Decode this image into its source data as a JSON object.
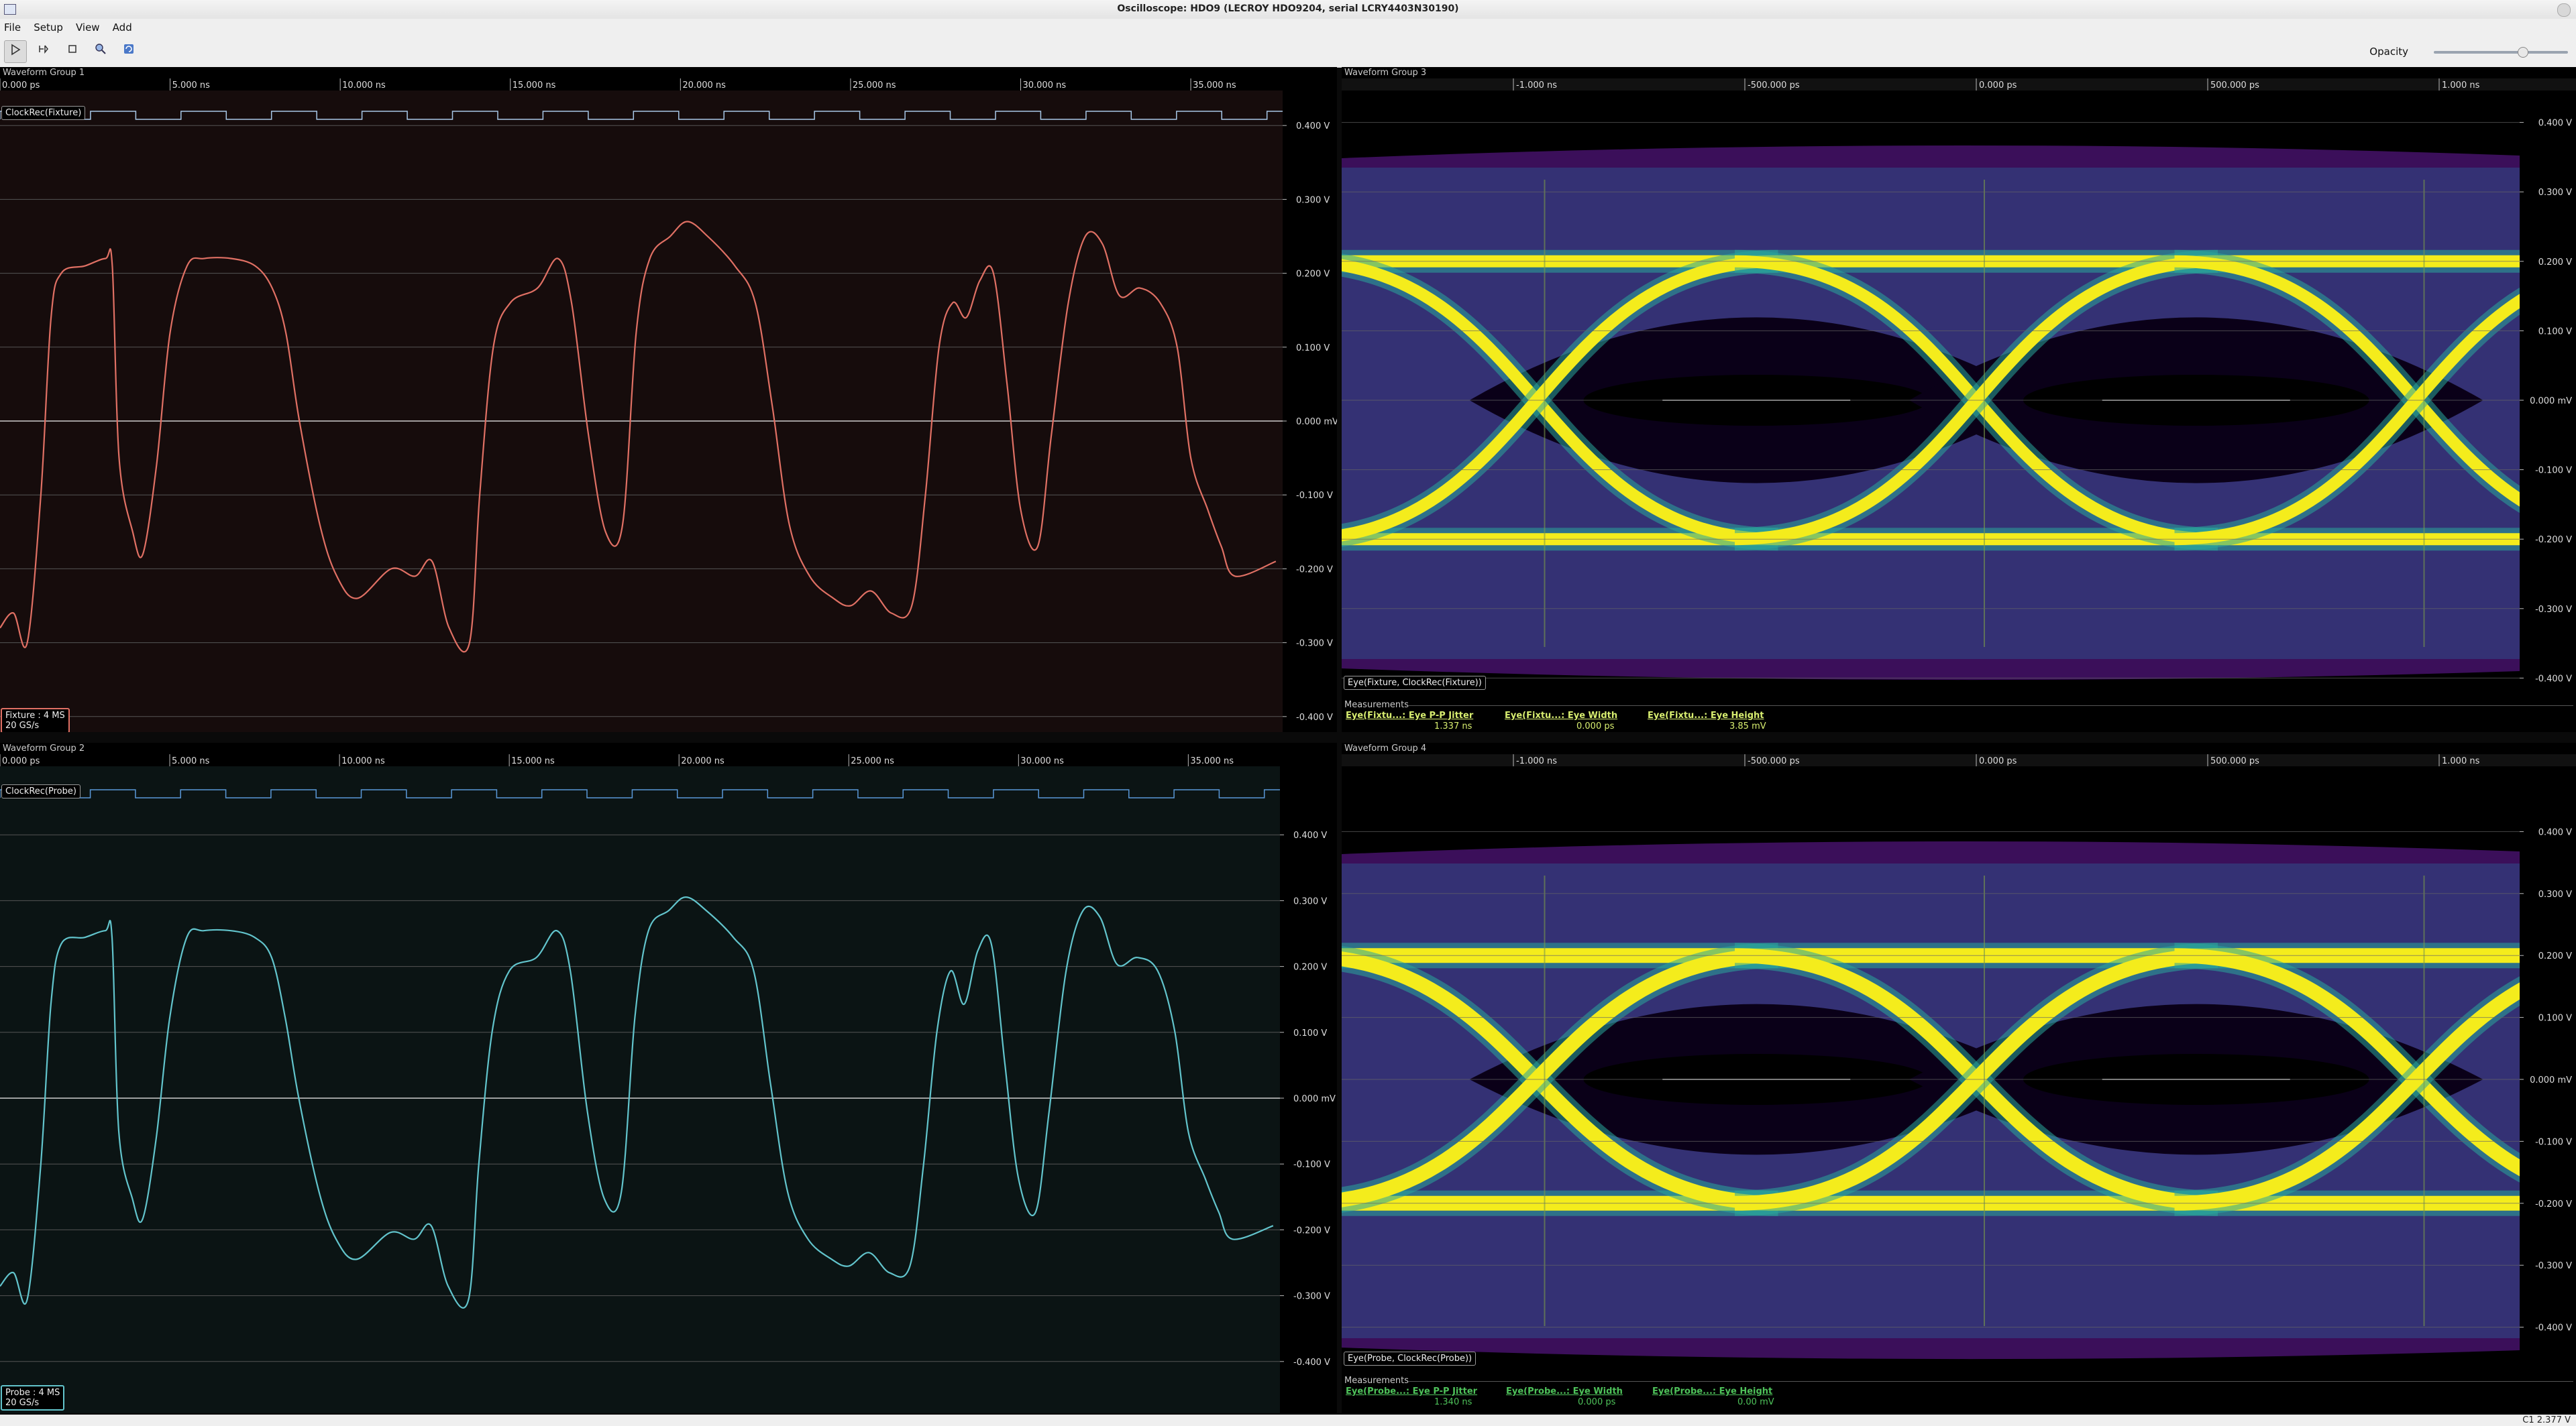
{
  "window": {
    "title": "Oscilloscope: HDO9 (LECROY HDO9204, serial LCRY4403N30190)"
  },
  "menu": [
    "File",
    "Setup",
    "View",
    "Add"
  ],
  "toolbar": {
    "opacity_label": "Opacity",
    "opacity_value": 0.62
  },
  "time_ticks": [
    "0.000 ps",
    "5.000 ns",
    "10.000 ns",
    "15.000 ns",
    "20.000 ns",
    "25.000 ns",
    "30.000 ns",
    "35.000 ns"
  ],
  "eye_time_ticks": [
    "-1.000 ns",
    "-500.000 ps",
    "0.000 ps",
    "500.000 ps",
    "1.000 ns"
  ],
  "v_ticks": [
    "0.400 V",
    "0.300 V",
    "0.200 V",
    "0.100 V",
    "0.000 mV",
    "-0.100 V",
    "-0.200 V",
    "-0.300 V",
    "-0.400 V"
  ],
  "group1": {
    "title": "Waveform Group 1",
    "clock_label": "ClockRec(Fixture)",
    "channel": {
      "name": "Fixture : 4 MS",
      "rate": "20 GS/s"
    },
    "colors": {
      "trace": "#e07064",
      "bg": "#160c0c",
      "clock": "#a8c8e8"
    }
  },
  "group2": {
    "title": "Waveform Group 2",
    "clock_label": "ClockRec(Probe)",
    "channel": {
      "name": "Probe : 4 MS",
      "rate": "20 GS/s"
    },
    "colors": {
      "trace": "#62c4cc",
      "bg": "#0b1414",
      "clock": "#5a98d8"
    }
  },
  "group3": {
    "title": "Waveform Group 3",
    "eye_label": "Eye(Fixture, ClockRec(Fixture))",
    "measurements_label": "Measurements",
    "measurements": [
      {
        "name": "Eye(Fixtu...: Eye P-P Jitter",
        "value": "1.337 ns"
      },
      {
        "name": "Eye(Fixtu...: Eye Width",
        "value": "0.000 ps"
      },
      {
        "name": "Eye(Fixtu...: Eye Height",
        "value": "3.85 mV"
      }
    ],
    "colors": {
      "meas_name": "#d8ee70",
      "meas_value": "#d8ee70"
    }
  },
  "group4": {
    "title": "Waveform Group 4",
    "eye_label": "Eye(Probe, ClockRec(Probe))",
    "measurements_label": "Measurements",
    "measurements": [
      {
        "name": "Eye(Probe...: Eye P-P Jitter",
        "value": "1.340 ns"
      },
      {
        "name": "Eye(Probe...: Eye Width",
        "value": "0.000 ps"
      },
      {
        "name": "Eye(Probe...: Eye Height",
        "value": "0.00 mV"
      }
    ],
    "colors": {
      "meas_name": "#4ec25a",
      "meas_value": "#4ec25a"
    }
  },
  "status": {
    "text": "C1 2.377 V"
  }
}
